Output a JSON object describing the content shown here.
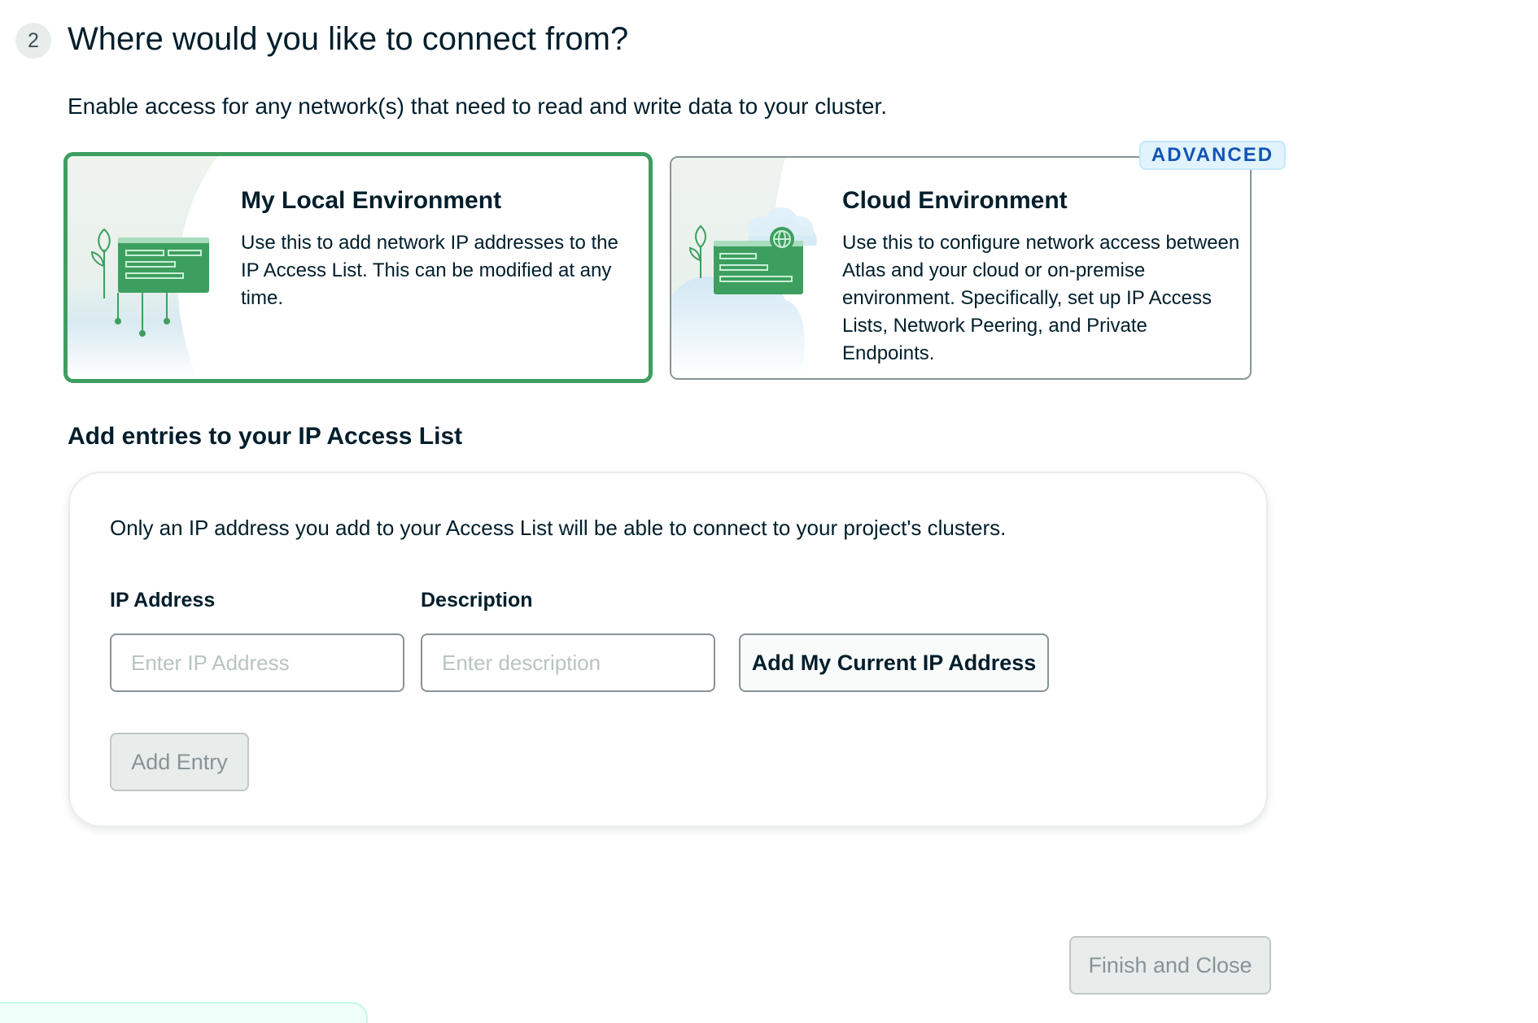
{
  "step": {
    "number": "2",
    "title": "Where would you like to connect from?",
    "subtitle": "Enable access for any network(s) that need to read and write data to your cluster."
  },
  "environments": {
    "local": {
      "title": "My Local Environment",
      "description": "Use this to add network IP addresses to the IP Access List. This can be modified at any time.",
      "selected": true
    },
    "cloud": {
      "title": "Cloud Environment",
      "description": "Use this to configure network access between Atlas and your cloud or on-premise environment. Specifically, set up IP Access Lists, Network Peering, and Private Endpoints.",
      "badge": "ADVANCED"
    }
  },
  "access_list": {
    "title": "Add entries to your IP Access List",
    "note": "Only an IP address you add to your Access List will be able to connect to your project's clusters.",
    "ip_label": "IP Address",
    "ip_placeholder": "Enter IP Address",
    "description_label": "Description",
    "description_placeholder": "Enter description",
    "current_ip_button": "Add My Current IP Address",
    "add_entry_button": "Add Entry"
  },
  "footer": {
    "finish_button": "Finish and Close"
  },
  "colors": {
    "selected_border": "#3d9f5f",
    "badge_text": "#1254b7",
    "badge_bg": "#e1f4fd",
    "illustration_green": "#3d9f5f",
    "disabled_bg": "#e8edeb"
  }
}
